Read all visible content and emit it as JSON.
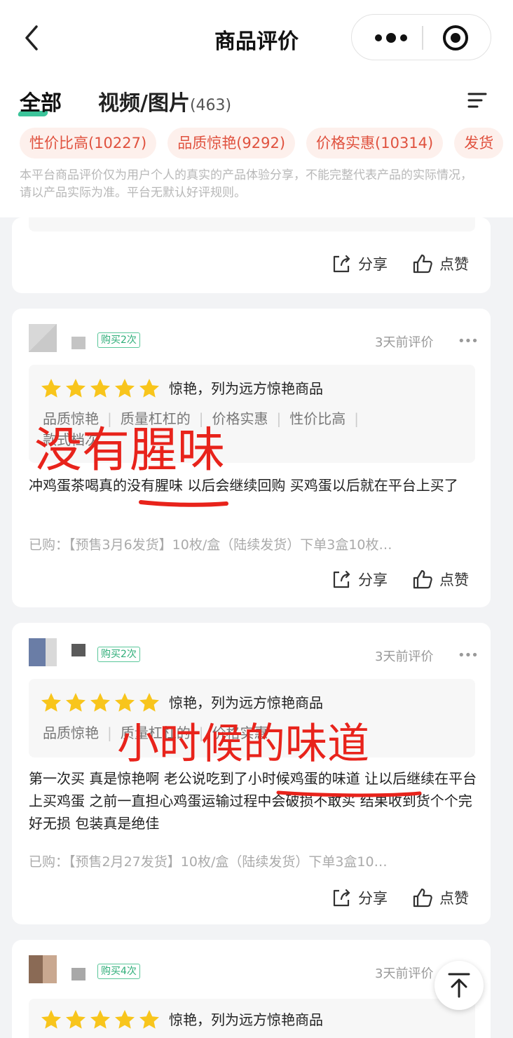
{
  "header": {
    "title": "商品评价"
  },
  "tabs": {
    "all": "全部",
    "media": "视频/图片",
    "media_count": "(463)"
  },
  "chips": [
    "性价比高(10227)",
    "品质惊艳(9292)",
    "价格实惠(10314)",
    "发货"
  ],
  "disclaimer": "本平台商品评价仅为用户个人的真实的产品体验分享，不能完整代表产品的实际情况，请以产品实际为准。平台无默认好评规则。",
  "actions": {
    "share": "分享",
    "like": "点赞"
  },
  "reviews": [
    {
      "badge": "购买2次",
      "time": "3天前评价",
      "rating": 5,
      "rating_label": "惊艳，列为远方惊艳商品",
      "tags": [
        "品质惊艳",
        "质量杠杠的",
        "价格实惠",
        "性价比高",
        "款式档次"
      ],
      "content": "冲鸡蛋茶喝真的没有腥味 以后会继续回购 买鸡蛋以后就在平台上买了",
      "bought": "已购：【预售3月6发货】10枚/盒（陆续发货）下单3盒10枚…",
      "overlay": "没有腥味"
    },
    {
      "badge": "购买2次",
      "time": "3天前评价",
      "rating": 5,
      "rating_label": "惊艳，列为远方惊艳商品",
      "tags": [
        "品质惊艳",
        "质量杠杠的",
        "价格实惠"
      ],
      "content": "第一次买 真是惊艳啊 老公说吃到了小时候鸡蛋的味道 让以后继续在平台上买鸡蛋 之前一直担心鸡蛋运输过程中会破损不敢买 结果收到货个个完好无损 包装真是绝佳",
      "bought": "已购：【预售2月27发货】10枚/盒（陆续发货）下单3盒10…",
      "overlay": "小时候的味道"
    },
    {
      "badge": "购买4次",
      "time": "3天前评价",
      "rating": 5,
      "rating_label": "惊艳，列为远方惊艳商品"
    }
  ],
  "colors": {
    "accent": "#3cc49a",
    "chip_text": "#e0523f",
    "chip_bg": "#fdf0ec",
    "star": "#f8c51c",
    "annotation": "#e8231b"
  },
  "icons": [
    "back-arrow-icon",
    "more-dots-icon",
    "target-icon",
    "menu-icon",
    "share-icon",
    "thumbs-up-icon",
    "star-icon",
    "scroll-top-icon"
  ]
}
